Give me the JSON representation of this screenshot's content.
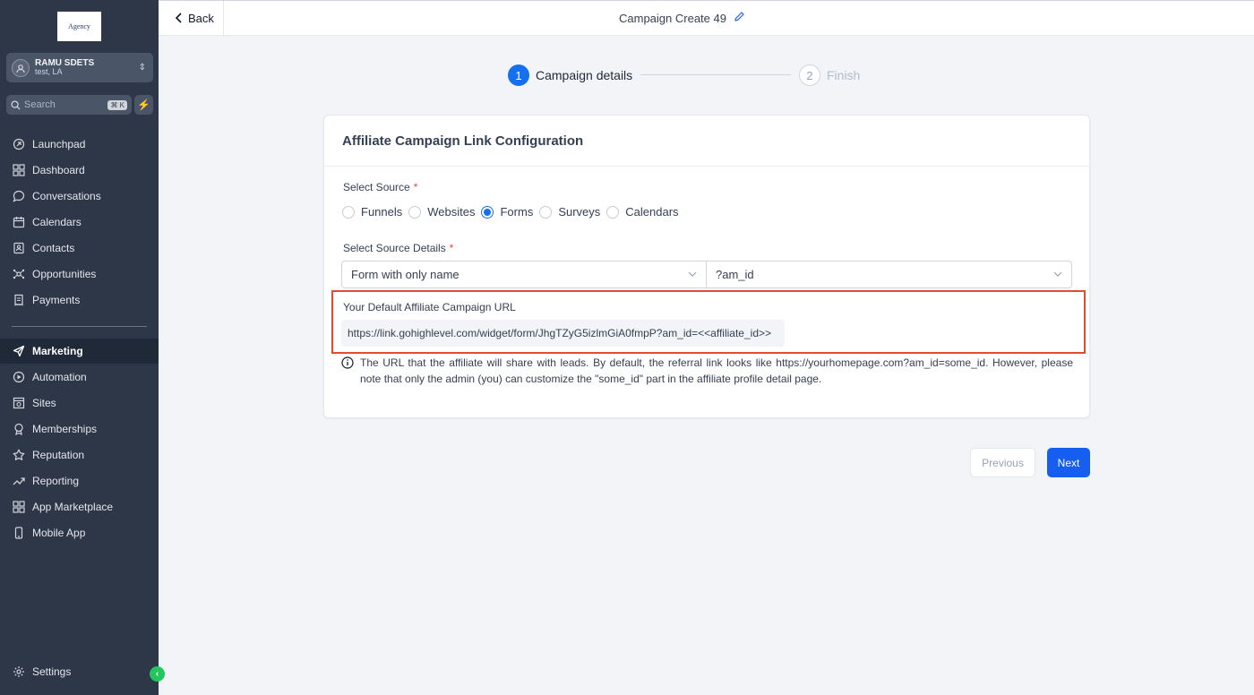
{
  "sidebar": {
    "logo_text": "Agency",
    "account": {
      "name": "RAMU SDETS",
      "location": "test, LA"
    },
    "search": {
      "placeholder": "Search",
      "shortcut": "⌘ K"
    },
    "items": [
      {
        "label": "Launchpad",
        "icon": "rocket-icon"
      },
      {
        "label": "Dashboard",
        "icon": "grid-icon"
      },
      {
        "label": "Conversations",
        "icon": "chat-icon"
      },
      {
        "label": "Calendars",
        "icon": "calendar-icon"
      },
      {
        "label": "Contacts",
        "icon": "contacts-icon"
      },
      {
        "label": "Opportunities",
        "icon": "network-icon"
      },
      {
        "label": "Payments",
        "icon": "receipt-icon"
      },
      {
        "label": "Marketing",
        "icon": "send-icon",
        "active": true
      },
      {
        "label": "Automation",
        "icon": "automation-icon"
      },
      {
        "label": "Sites",
        "icon": "sites-icon"
      },
      {
        "label": "Memberships",
        "icon": "badge-icon"
      },
      {
        "label": "Reputation",
        "icon": "star-icon"
      },
      {
        "label": "Reporting",
        "icon": "trend-icon"
      },
      {
        "label": "App Marketplace",
        "icon": "apps-icon"
      },
      {
        "label": "Mobile App",
        "icon": "phone-icon"
      }
    ],
    "settings_label": "Settings"
  },
  "topbar": {
    "back_label": "Back",
    "title": "Campaign Create 49"
  },
  "steps": [
    {
      "number": "1",
      "label": "Campaign details",
      "state": "active"
    },
    {
      "number": "2",
      "label": "Finish",
      "state": "pending"
    }
  ],
  "card": {
    "heading": "Affiliate Campaign Link Configuration",
    "source_label": "Select Source",
    "required_mark": "*",
    "sources": [
      {
        "label": "Funnels",
        "selected": false
      },
      {
        "label": "Websites",
        "selected": false
      },
      {
        "label": "Forms",
        "selected": true
      },
      {
        "label": "Surveys",
        "selected": false
      },
      {
        "label": "Calendars",
        "selected": false
      }
    ],
    "details_label": "Select Source Details",
    "form_select_value": "Form with only name",
    "param_select_value": "?am_id",
    "url_label": "Your Default Affiliate Campaign URL",
    "url_value": "https://link.gohighlevel.com/widget/form/JhgTZyG5izlmGiA0fmpP?am_id=<<affiliate_id>>",
    "note": "The URL that the affiliate will share with leads. By default, the referral link looks like https://yourhomepage.com?am_id=some_id. However, please note that only the admin (you) can customize the \"some_id\" part in the affiliate profile detail page."
  },
  "buttons": {
    "previous": "Previous",
    "next": "Next"
  },
  "colors": {
    "sidebar_bg": "#2d3748",
    "primary": "#155eef",
    "highlight": "#e34a2f"
  }
}
